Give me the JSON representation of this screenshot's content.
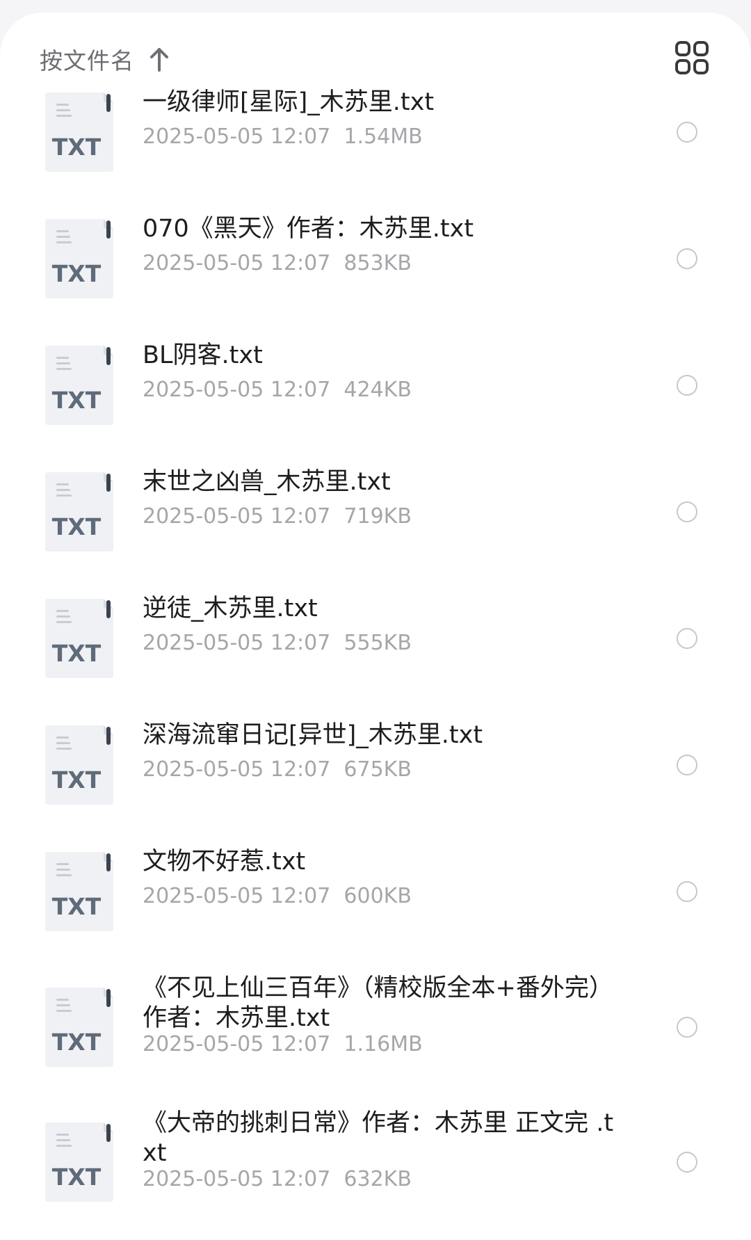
{
  "toolbar": {
    "sort_label": "按文件名",
    "sort_direction_icon": "arrow-up-icon",
    "view_toggle_icon": "grid-view-icon"
  },
  "file_icon_label": "TXT",
  "files": [
    {
      "name": "一级律师[星际]_木苏里.txt",
      "date": "2025-05-05 12:07",
      "size": "1.54MB"
    },
    {
      "name": "070《黑天》作者：木苏里.txt",
      "date": "2025-05-05 12:07",
      "size": "853KB"
    },
    {
      "name": "BL阴客.txt",
      "date": "2025-05-05 12:07",
      "size": "424KB"
    },
    {
      "name": "末世之凶兽_木苏里.txt",
      "date": "2025-05-05 12:07",
      "size": "719KB"
    },
    {
      "name": "逆徒_木苏里.txt",
      "date": "2025-05-05 12:07",
      "size": "555KB"
    },
    {
      "name": "深海流窜日记[异世]_木苏里.txt",
      "date": "2025-05-05 12:07",
      "size": "675KB"
    },
    {
      "name": "文物不好惹.txt",
      "date": "2025-05-05 12:07",
      "size": "600KB"
    },
    {
      "name": "《不见上仙三百年》（精校版全本+番外完）作者：木苏里.txt",
      "date": "2025-05-05 12:07",
      "size": "1.16MB"
    },
    {
      "name": "《大帝的挑刺日常》作者：木苏里 正文完 .txt",
      "date": "2025-05-05 12:07",
      "size": "632KB"
    }
  ],
  "colors": {
    "background": "#f5f5f7",
    "sheet": "#ffffff",
    "title_text": "#1d1d1f",
    "meta_text": "#a6a6aa",
    "sort_text": "#6e6e73",
    "icon_bg": "#f0f1f4",
    "icon_text": "#5f6b7a"
  }
}
